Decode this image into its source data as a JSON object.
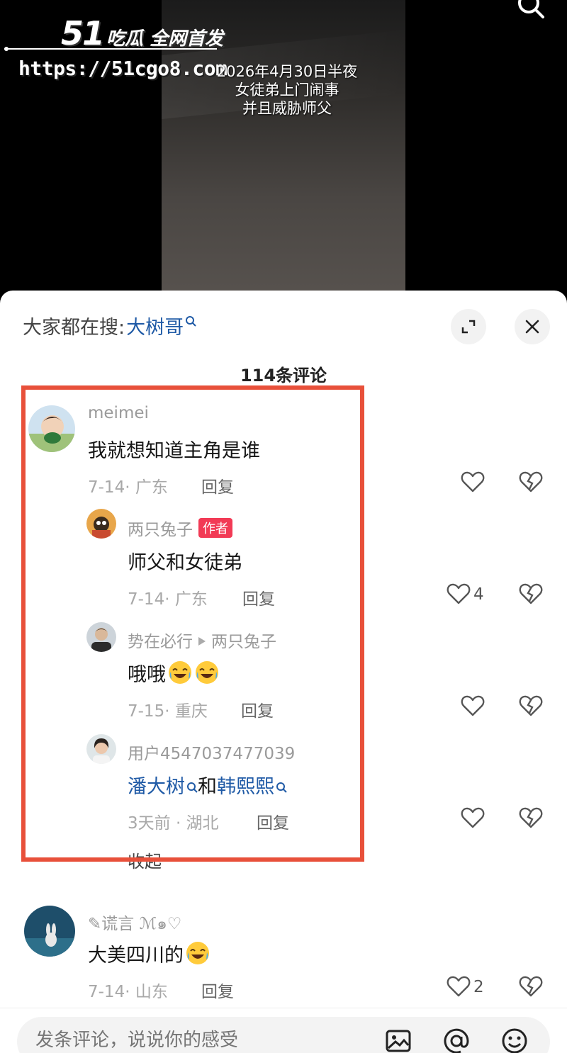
{
  "watermark": {
    "number": "51",
    "tagline": "吃瓜 全网首发",
    "url": "https://51cgo8.com"
  },
  "video": {
    "overlay_lines": [
      "2026年4月30日半夜",
      "女徒弟上门闹事",
      "并且威胁师父"
    ]
  },
  "panel": {
    "search_prefix": "大家都在搜:",
    "search_term": "大树哥",
    "comment_count": "114条评论",
    "collapse_label": "收起"
  },
  "comments": [
    {
      "user": "meimei",
      "text": "我就想知道主角是谁",
      "date": "7-14",
      "location": "广东",
      "reply_label": "回复",
      "likes": ""
    },
    {
      "user": "两只兔子",
      "badge": "作者",
      "text": "师父和女徒弟",
      "date": "7-14",
      "location": "广东",
      "reply_label": "回复",
      "likes": "4"
    },
    {
      "user": "势在必行",
      "reply_to": "两只兔子",
      "text": "哦哦",
      "date": "7-15",
      "location": "重庆",
      "reply_label": "回复",
      "likes": ""
    },
    {
      "user": "用户4547037477039",
      "text_link1": "潘大树",
      "text_mid": "和",
      "text_link2": "韩熙熙",
      "date": "3天前",
      "location": "湖北",
      "reply_label": "回复",
      "likes": ""
    },
    {
      "user": "✎谎言",
      "user_suffix": "ℳ๑♡",
      "text": "大美四川的",
      "date": "7-14",
      "location": "山东",
      "reply_label": "回复",
      "likes": "2"
    }
  ],
  "input": {
    "placeholder": "发条评论，说说你的感受"
  },
  "colors": {
    "highlight": "#e8503a",
    "link": "#1f5aa6",
    "author_badge": "#f23a55"
  }
}
